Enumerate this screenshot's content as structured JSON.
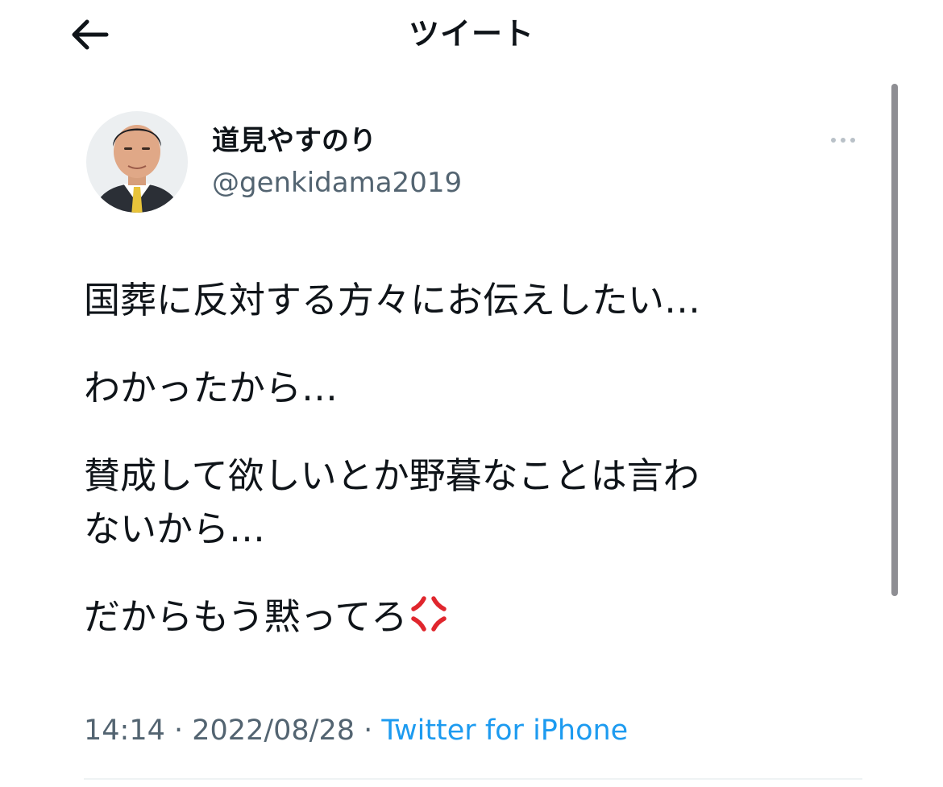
{
  "header": {
    "back_icon": "arrow-left-icon",
    "title": "ツイート"
  },
  "author": {
    "display_name": "道見やすのり",
    "handle": "@genkidama2019",
    "avatar": "profile-photo"
  },
  "more_icon": "more-horizontal-icon",
  "tweet": {
    "lines": [
      "国葬に反対する方々にお伝えしたい…",
      "わかったから…",
      "賛成して欲しいとか野暮なことは言わ",
      "ないから…",
      "だからもう黙ってろ"
    ],
    "emoji": "anger-symbol-emoji"
  },
  "meta": {
    "time": "14:14",
    "separator": " · ",
    "date": "2022/08/28",
    "source": "Twitter for iPhone"
  },
  "colors": {
    "text": "#0f1419",
    "secondary": "#536471",
    "link": "#1d9bf0",
    "anger": "#e0262d"
  }
}
